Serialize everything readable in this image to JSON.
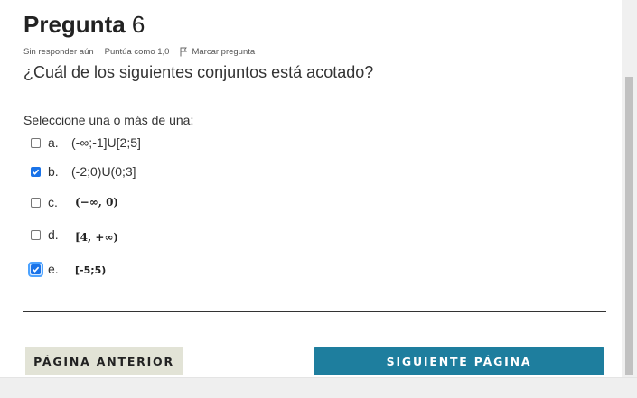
{
  "question": {
    "title_word": "Pregunta",
    "number": "6",
    "status": "Sin responder aún",
    "score": "Puntúa como 1,0",
    "flag_label": "Marcar pregunta",
    "text": "¿Cuál de los siguientes conjuntos está acotado?",
    "prompt": "Seleccione una o más de una:"
  },
  "options": [
    {
      "letter": "a.",
      "text": "(-∞;-1]U[2;5]",
      "checked": false
    },
    {
      "letter": "b.",
      "text": "(-2;0)U(0;3]",
      "checked": true
    },
    {
      "letter": "c.",
      "text": "(−∞, 0)",
      "checked": false
    },
    {
      "letter": "d.",
      "text": "[4, +∞)",
      "checked": false
    },
    {
      "letter": "e.",
      "text": "[-5;5)",
      "checked": true
    }
  ],
  "nav": {
    "prev_label": "PÁGINA ANTERIOR",
    "next_label": "SIGUIENTE PÁGINA"
  },
  "colors": {
    "next_button": "#1e7e9e",
    "prev_button": "#e2e3d6",
    "checkbox_checked": "#1a73e8"
  }
}
